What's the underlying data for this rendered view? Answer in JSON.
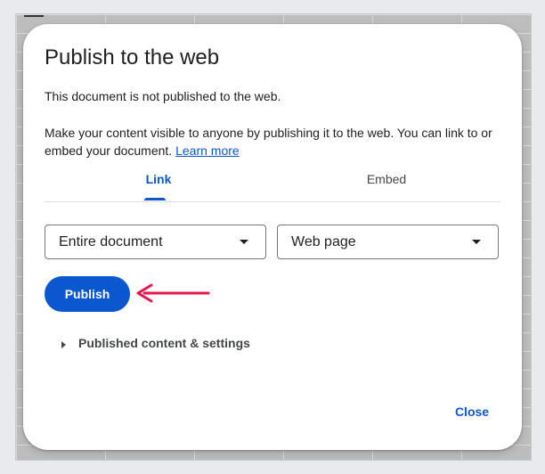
{
  "dialog": {
    "title": "Publish to the web",
    "status": "This document is not published to the web.",
    "description": "Make your content visible to anyone by publishing it to the web. You can link to or embed your document.",
    "learn_more": "Learn more"
  },
  "tabs": [
    {
      "label": "Link",
      "active": true
    },
    {
      "label": "Embed",
      "active": false
    }
  ],
  "selects": {
    "scope": "Entire document",
    "format": "Web page"
  },
  "publish_button": "Publish",
  "expander": {
    "label": "Published content & settings",
    "icon": "triangle-right-icon"
  },
  "close_button": "Close",
  "annotation": {
    "arrow_color": "#e8174b"
  },
  "colors": {
    "accent": "#0b57d0",
    "text": "#1f1f1f"
  }
}
